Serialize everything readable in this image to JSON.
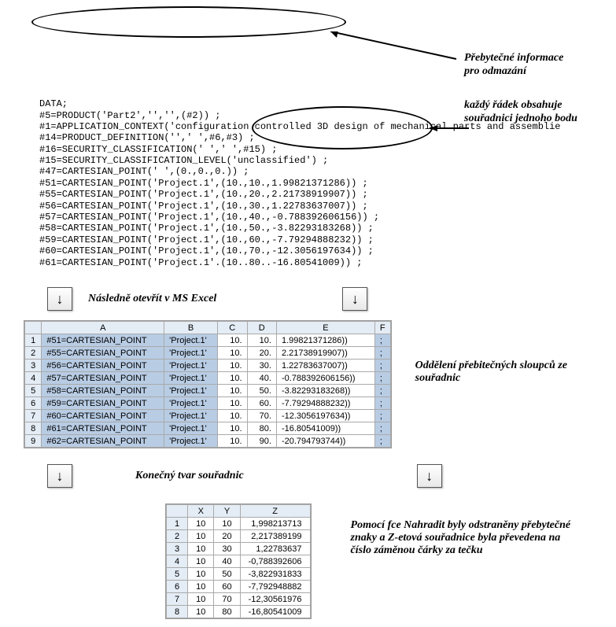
{
  "code": {
    "lines": [
      "DATA;",
      "#5=PRODUCT('Part2','','',(#2)) ;",
      "#1=APPLICATION_CONTEXT('configuration controlled 3D design of mechanical parts and assemblie",
      "#14=PRODUCT_DEFINITION('',' ',#6,#3) ;",
      "#16=SECURITY_CLASSIFICATION(' ',' ',#15) ;",
      "#15=SECURITY_CLASSIFICATION_LEVEL('unclassified') ;",
      "#47=CARTESIAN_POINT(' ',(0.,0.,0.)) ;",
      "#51=CARTESIAN_POINT('Project.1',(10.,10.,1.99821371286)) ;",
      "#55=CARTESIAN_POINT('Project.1',(10.,20.,2.21738919907)) ;",
      "#56=CARTESIAN_POINT('Project.1',(10.,30.,1.22783637007)) ;",
      "#57=CARTESIAN_POINT('Project.1',(10.,40.,-0.788392606156)) ;",
      "#58=CARTESIAN_POINT('Project.1',(10.,50.,-3.82293183268)) ;",
      "#59=CARTESIAN_POINT('Project.1',(10.,60.,-7.79294888232)) ;",
      "#60=CARTESIAN_POINT('Project.1',(10.,70.,-12.3056197634)) ;",
      "#61=CARTESIAN_POINT('Project.1'.(10..80..-16.80541009)) ;"
    ]
  },
  "annotations": {
    "redundant": "Přebytečné informace\npro odmazání",
    "each_row": "každý řádek obsahuje\nsouřadnici jednoho bodu",
    "open_excel": "Následně otevřít v MS Excel",
    "remove_cols": "Oddělení přebitečných\nsloupců ze souřadnic",
    "final_shape": "Konečný tvar souřadnic",
    "replace_note": "Pomocí fce Nahradit byly odstraněny přebytečné znaky a Z-etová souřadnice byla převedena na číslo záměnou čárky za tečku"
  },
  "sheet1": {
    "cols": [
      "A",
      "B",
      "C",
      "D",
      "E",
      "F"
    ],
    "rows": [
      {
        "n": "1",
        "A": "#51=CARTESIAN_POINT",
        "B": "'Project.1'",
        "C": "10.",
        "D": "10.",
        "E": "1.99821371286))",
        "F": ";"
      },
      {
        "n": "2",
        "A": "#55=CARTESIAN_POINT",
        "B": "'Project.1'",
        "C": "10.",
        "D": "20.",
        "E": "2.21738919907))",
        "F": ";"
      },
      {
        "n": "3",
        "A": "#56=CARTESIAN_POINT",
        "B": "'Project.1'",
        "C": "10.",
        "D": "30.",
        "E": "1.22783637007))",
        "F": ";"
      },
      {
        "n": "4",
        "A": "#57=CARTESIAN_POINT",
        "B": "'Project.1'",
        "C": "10.",
        "D": "40.",
        "E": "-0.788392606156))",
        "F": ";"
      },
      {
        "n": "5",
        "A": "#58=CARTESIAN_POINT",
        "B": "'Project.1'",
        "C": "10.",
        "D": "50.",
        "E": "-3.82293183268))",
        "F": ";"
      },
      {
        "n": "6",
        "A": "#59=CARTESIAN_POINT",
        "B": "'Project.1'",
        "C": "10.",
        "D": "60.",
        "E": "-7.79294888232))",
        "F": ";"
      },
      {
        "n": "7",
        "A": "#60=CARTESIAN_POINT",
        "B": "'Project.1'",
        "C": "10.",
        "D": "70.",
        "E": "-12.3056197634))",
        "F": ";"
      },
      {
        "n": "8",
        "A": "#61=CARTESIAN_POINT",
        "B": "'Project.1'",
        "C": "10.",
        "D": "80.",
        "E": "-16.80541009))",
        "F": ";"
      },
      {
        "n": "9",
        "A": "#62=CARTESIAN_POINT",
        "B": "'Project.1'",
        "C": "10.",
        "D": "90.",
        "E": "-20.794793744))",
        "F": ";"
      }
    ]
  },
  "sheet2": {
    "cols": [
      "",
      "X",
      "Y",
      "Z"
    ],
    "rows": [
      {
        "n": "1",
        "X": "10",
        "Y": "10",
        "Z": "1,998213713"
      },
      {
        "n": "2",
        "X": "10",
        "Y": "20",
        "Z": "2,217389199"
      },
      {
        "n": "3",
        "X": "10",
        "Y": "30",
        "Z": "1,22783637"
      },
      {
        "n": "4",
        "X": "10",
        "Y": "40",
        "Z": "-0,788392606"
      },
      {
        "n": "5",
        "X": "10",
        "Y": "50",
        "Z": "-3,822931833"
      },
      {
        "n": "6",
        "X": "10",
        "Y": "60",
        "Z": "-7,792948882"
      },
      {
        "n": "7",
        "X": "10",
        "Y": "70",
        "Z": "-12,30561976"
      },
      {
        "n": "8",
        "X": "10",
        "Y": "80",
        "Z": "-16,80541009"
      }
    ]
  }
}
